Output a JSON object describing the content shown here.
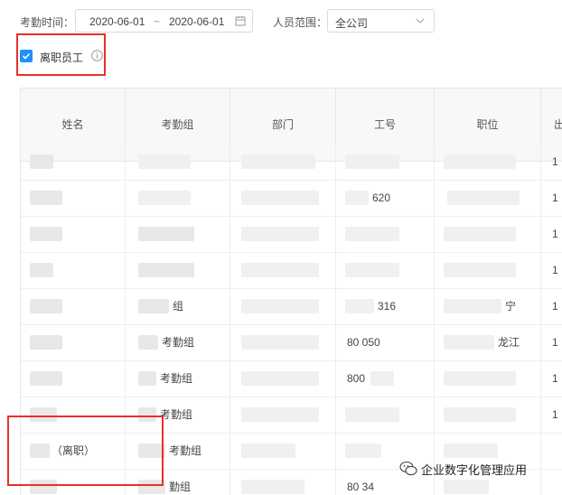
{
  "filters": {
    "date_label": "考勤时间：",
    "date_start": "2020-06-01",
    "date_sep": "~",
    "date_end": "2020-06-01",
    "scope_label": "人员范围：",
    "scope_value": "全公司"
  },
  "checkbox": {
    "label": "离职员工",
    "checked": true
  },
  "table": {
    "columns": [
      "姓名",
      "考勤组",
      "部门",
      "工号",
      "职位",
      "出"
    ],
    "rows": [
      {
        "name": "",
        "group": "",
        "dept": "",
        "id": "",
        "pos": "",
        "out": "1"
      },
      {
        "name": "",
        "group": "",
        "dept": "",
        "id": "620",
        "pos": "",
        "out": "1"
      },
      {
        "name": "",
        "group": "",
        "dept": "",
        "id": "",
        "pos": "",
        "out": "1"
      },
      {
        "name": "",
        "group": "",
        "dept": "",
        "id": "",
        "pos": "",
        "out": "1"
      },
      {
        "name": "",
        "group": "组",
        "dept": "",
        "id": "316",
        "pos": "宁",
        "out": "1"
      },
      {
        "name": "",
        "group": "考勤组",
        "dept": "",
        "id": "80 050",
        "pos": "龙江",
        "out": "1"
      },
      {
        "name": "",
        "group": "考勤组",
        "dept": "",
        "id": "800",
        "pos": "",
        "out": "1"
      },
      {
        "name": "",
        "group": "考勤组",
        "dept": "",
        "id": "",
        "pos": "",
        "out": "1"
      },
      {
        "name": "（离职）",
        "group": "考勤组",
        "dept": "",
        "id": "",
        "pos": "",
        "out": ""
      },
      {
        "name": "",
        "group": "勤组",
        "dept": "",
        "id": "80 34",
        "pos": "",
        "out": ""
      }
    ]
  },
  "watermark": {
    "text": "企业数字化管理应用"
  },
  "colors": {
    "accent": "#1e90ff",
    "highlight_border": "#e8302a"
  }
}
